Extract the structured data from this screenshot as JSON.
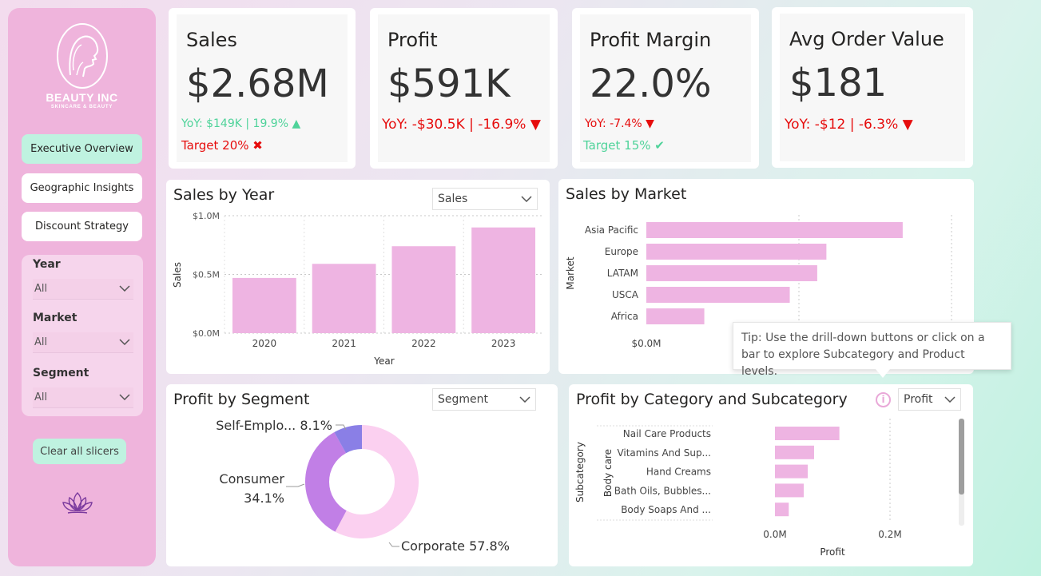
{
  "brand": {
    "name": "BEAUTY INC",
    "tagline": "SKINCARE & BEAUTY"
  },
  "nav": [
    {
      "label": "Executive Overview",
      "active": true
    },
    {
      "label": "Geographic Insights",
      "active": false
    },
    {
      "label": "Discount Strategy",
      "active": false
    }
  ],
  "slicers": [
    {
      "title": "Year",
      "value": "All"
    },
    {
      "title": "Market",
      "value": "All"
    },
    {
      "title": "Segment",
      "value": "All"
    }
  ],
  "clear_label": "Clear all slicers",
  "colors": {
    "bar": "#eeb4e2",
    "positive": "#4fd39a",
    "negative": "#e60c0c",
    "accent": "#bff2e0"
  },
  "kpis": [
    {
      "title": "Sales",
      "value": "$2.68M",
      "yoy": "YoY: $149K | 19.9% ▲",
      "yoy_status": "pos",
      "target": "Target 20% ✖",
      "target_status": "neg"
    },
    {
      "title": "Profit",
      "value": "$591K",
      "yoy": "YoY: -$30.5K | -16.9% ▼",
      "yoy_status": "neg",
      "target": "",
      "target_status": ""
    },
    {
      "title": "Profit Margin",
      "value": "22.0%",
      "yoy": "YoY: -7.4% ▼",
      "yoy_status": "neg",
      "target": "Target 15% ✔",
      "target_status": "pos"
    },
    {
      "title": "Avg Order Value",
      "value": "$181",
      "yoy": "YoY: -$12 | -6.3% ▼",
      "yoy_status": "neg",
      "target": "",
      "target_status": ""
    }
  ],
  "sales_by_year": {
    "title": "Sales by Year",
    "dropdown": "Sales"
  },
  "sales_by_market": {
    "title": "Sales by Market"
  },
  "profit_by_segment": {
    "title": "Profit by Segment",
    "dropdown": "Segment"
  },
  "profit_by_category": {
    "title": "Profit by Category and Subcategory",
    "dropdown": "Profit",
    "info_icon": "i"
  },
  "tooltip": "Tip: Use the drill-down buttons or click on a bar to explore Subcategory and Product levels.",
  "chart_data": [
    {
      "type": "bar",
      "title": "Sales by Year",
      "categories": [
        "2020",
        "2021",
        "2022",
        "2023"
      ],
      "values": [
        0.47,
        0.59,
        0.74,
        0.9
      ],
      "ticks": [
        "$0.0M",
        "$0.5M",
        "$1.0M"
      ],
      "tick_values": [
        0,
        0.5,
        1.0
      ],
      "xlabel": "Year",
      "ylabel": "Sales",
      "ylim": [
        0,
        1.0
      ],
      "grid": true
    },
    {
      "type": "bar",
      "orientation": "horizontal",
      "title": "Sales by Market",
      "categories": [
        "Asia Pacific",
        "Europe",
        "LATAM",
        "USCA",
        "Africa"
      ],
      "values": [
        0.84,
        0.59,
        0.56,
        0.47,
        0.19
      ],
      "ticks": [
        "$0.0M"
      ],
      "ylabel": "Market",
      "xlim": [
        0,
        1.0
      ],
      "grid": true
    },
    {
      "type": "pie",
      "variant": "donut",
      "title": "Profit by Segment",
      "slices": [
        {
          "name": "Corporate",
          "label": "Corporate 57.8%",
          "value": 57.8,
          "color": "#fbd0f0"
        },
        {
          "name": "Consumer",
          "label": "Consumer",
          "pct": "34.1%",
          "value": 34.1,
          "color": "#c17fe6"
        },
        {
          "name": "Self-Employed",
          "label": "Self-Emplo... 8.1%",
          "value": 8.1,
          "color": "#8a7fe6"
        }
      ]
    },
    {
      "type": "bar",
      "orientation": "horizontal",
      "title": "Profit by Category and Subcategory",
      "group_label": "Body care",
      "categories": [
        "Nail Care Products",
        "Vitamins And Sup...",
        "Hand Creams",
        "Bath Oils, Bubbles...",
        "Body Soaps And ..."
      ],
      "values": [
        0.112,
        0.068,
        0.057,
        0.05,
        0.024
      ],
      "ticks": [
        "0.0M",
        "0.2M"
      ],
      "tick_values": [
        0,
        0.2
      ],
      "xlabel": "Profit",
      "ylabel": "Subcategory",
      "xlim": [
        0,
        0.2
      ]
    }
  ]
}
